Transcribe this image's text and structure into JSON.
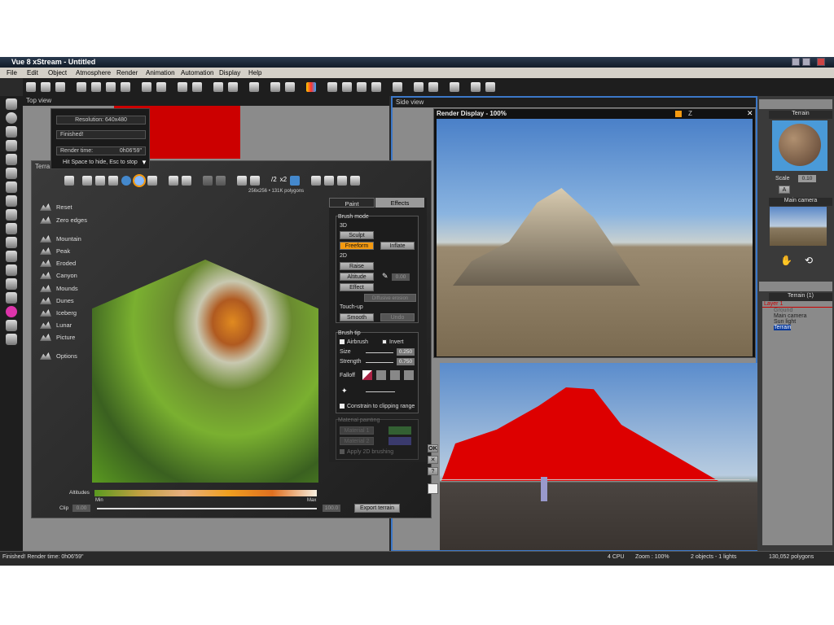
{
  "app": {
    "title": "Vue 8 xStream - Untitled"
  },
  "menu": [
    "File",
    "Edit",
    "Object",
    "Atmosphere",
    "Render",
    "Animation",
    "Automation",
    "Display",
    "Help"
  ],
  "viewports": {
    "top": "Top view",
    "side": "Side view"
  },
  "render_popup": {
    "resolution": "Resolution: 640x480",
    "status": "Finished!",
    "time_label": "Render time:",
    "time_value": "0h06'59\"",
    "hint": "Hit Space to hide, Esc to stop"
  },
  "terrain_editor": {
    "title": "Terra",
    "info": "256x256 • 131K polygons",
    "toolbar_labels": {
      "half": "/2",
      "double": "x2"
    },
    "presets": [
      "Reset",
      "Zero edges",
      "Mountain",
      "Peak",
      "Eroded",
      "Canyon",
      "Mounds",
      "Dunes",
      "Iceberg",
      "Lunar",
      "Picture",
      "Options"
    ],
    "altitudes_label": "Altitudes",
    "min": "Min",
    "max": "Max",
    "clip_label": "Clip",
    "clip_min": "0.00",
    "clip_max": "100.0",
    "export": "Export terrain",
    "tabs": [
      "Paint",
      "Effects"
    ],
    "brush_mode": {
      "label": "Brush mode",
      "d3": "3D",
      "sculpt": "Sculpt",
      "freeform": "Freeform",
      "inflate": "Inflate",
      "d2": "2D",
      "raise": "Raise",
      "altitude": "Altitude",
      "altitude_value": "0.00",
      "effect": "Effect",
      "effect_select": "Diffusive erosion",
      "touchup": "Touch-up",
      "smooth": "Smooth",
      "undo": "Undo"
    },
    "brush_tip": {
      "label": "Brush tip",
      "airbrush": "Airbrush",
      "invert": "Invert",
      "size": "Size",
      "size_value": "0.250",
      "strength": "Strength",
      "strength_value": "0.750",
      "falloff": "Falloff",
      "constrain": "Constrain to clipping range"
    },
    "material": {
      "label": "Material painting",
      "m1": "Material 1",
      "m2": "Material 2",
      "apply": "Apply 2D brushing",
      "color1": "#3f8a3f",
      "color2": "#4a4aa0"
    },
    "side_buttons": {
      "ok": "OK",
      "close": "✕",
      "help": "?"
    }
  },
  "render_display": {
    "title": "Render Display - 100%",
    "z": "Z"
  },
  "right_panel": {
    "material_title": "Terrain",
    "scale_label": "Scale",
    "scale_value": "0.10",
    "mode": "A",
    "camera_title": "Main camera",
    "layer_title": "Terrain (1)",
    "tree": [
      "Layer 1",
      "Ground",
      "Main camera",
      "Sun light",
      "Terrain"
    ]
  },
  "status": {
    "message": "Finished! Render time: 0h06'59\"",
    "cpu": "4 CPU",
    "zoom": "Zoom : 100%",
    "objects": "2 objects - 1 lights",
    "polygons": "130,052 polygons"
  },
  "colors": {
    "accent": "#f59a10",
    "selection": "#3c78c8",
    "terrain_red": "#dd0000"
  }
}
